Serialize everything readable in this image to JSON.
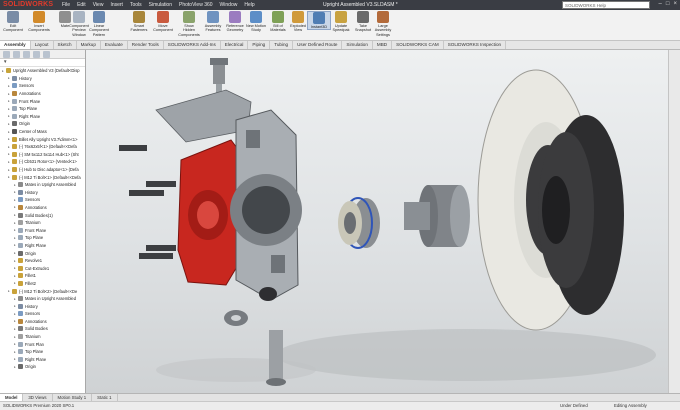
{
  "app": {
    "logo": "SOLIDWORKS",
    "doc_title": "Upright Assembled V3.SLDASM *"
  },
  "menu": [
    "File",
    "Edit",
    "View",
    "Insert",
    "Tools",
    "Simulation",
    "PhotoView 360",
    "Window",
    "Help"
  ],
  "search_placeholder": "SOLIDWORKS Help",
  "ribbon": [
    {
      "label": "Edit Component",
      "icon": "edit-component-icon",
      "color": "#7a8ca6"
    },
    {
      "label": "Insert Components",
      "icon": "insert-components-icon",
      "color": "#d28a2a"
    },
    {
      "label": "Mate",
      "icon": "mate-icon",
      "color": "#8f8f8f"
    },
    {
      "label": "Component Preview Window",
      "icon": "preview-window-icon",
      "color": "#a9b4c2"
    },
    {
      "label": "Linear Component Pattern",
      "icon": "linear-pattern-icon",
      "color": "#6b89b0"
    },
    {
      "label": "Smart Fasteners",
      "icon": "smart-fasteners-icon",
      "color": "#a8863a"
    },
    {
      "label": "Move Component",
      "icon": "move-component-icon",
      "color": "#c95a3e"
    },
    {
      "label": "Show Hidden Components",
      "icon": "show-hidden-icon",
      "color": "#8aa36b"
    },
    {
      "label": "Assembly Features",
      "icon": "assembly-features-icon",
      "color": "#6f93c0"
    },
    {
      "label": "Reference Geometry",
      "icon": "reference-geometry-icon",
      "color": "#9b7cc0"
    },
    {
      "label": "New Motion Study",
      "icon": "motion-study-icon",
      "color": "#5d8ec7"
    },
    {
      "label": "Bill of Materials",
      "icon": "bill-of-materials-icon",
      "color": "#7fa157"
    },
    {
      "label": "Exploded View",
      "icon": "exploded-view-icon",
      "color": "#d09a3b"
    },
    {
      "label": "Instant3D",
      "icon": "instant3d-icon",
      "color": "#4f7db3"
    },
    {
      "label": "Update Speedpak",
      "icon": "update-speedpak-icon",
      "color": "#c8a240"
    },
    {
      "label": "Take Snapshot",
      "icon": "take-snapshot-icon",
      "color": "#6a6a6a"
    },
    {
      "label": "Large Assembly Settings",
      "icon": "large-assembly-icon",
      "color": "#b36a3a"
    }
  ],
  "tabs": [
    "Assembly",
    "Layout",
    "Sketch",
    "Markup",
    "Evaluate",
    "Render Tools",
    "SOLIDWORKS Add-Ins",
    "Electrical",
    "Piping",
    "Tubing",
    "User Defined Route",
    "Simulation",
    "MBD",
    "SOLIDWORKS CAM",
    "SOLIDWORKS Inspection"
  ],
  "tree": {
    "filter_icon": "filter-icon",
    "rows": [
      {
        "label": "Upright Assembled V3 (Default<Disp",
        "level": 0,
        "icon": "assembly-icon",
        "color": "#c7a43a"
      },
      {
        "label": "History",
        "level": 1,
        "icon": "history-icon",
        "color": "#7c8ca3"
      },
      {
        "label": "Sensors",
        "level": 1,
        "icon": "sensors-icon",
        "color": "#7b9bc2"
      },
      {
        "label": "Annotations",
        "level": 1,
        "icon": "annotations-icon",
        "color": "#b9873c"
      },
      {
        "label": "Front Plane",
        "level": 1,
        "icon": "plane-icon",
        "color": "#9ba9b9"
      },
      {
        "label": "Top Plane",
        "level": 1,
        "icon": "plane-icon",
        "color": "#9ba9b9"
      },
      {
        "label": "Right Plane",
        "level": 1,
        "icon": "plane-icon",
        "color": "#9ba9b9"
      },
      {
        "label": "Origin",
        "level": 1,
        "icon": "origin-icon",
        "color": "#6b6b6b"
      },
      {
        "label": "Center of Mass",
        "level": 1,
        "icon": "center-of-mass-icon",
        "color": "#555"
      },
      {
        "label": "Billet Ally Upright V3.7\\dimm<1>",
        "level": 1,
        "icon": "part-icon",
        "color": "#c9a23a"
      },
      {
        "label": "(-) 76x62x5f<1> (Default<<Defa",
        "level": 1,
        "icon": "part-icon",
        "color": "#c9a23a"
      },
      {
        "label": "(-) SM 5x112 5x114 Hub<1> (Sht",
        "level": 1,
        "icon": "part-icon",
        "color": "#c9a23a"
      },
      {
        "label": "(-) Cb531 Rotor<1> (Vented<1>",
        "level": 1,
        "icon": "part-icon",
        "color": "#c9a23a"
      },
      {
        "label": "(-) Hub to Disc adaptor<1> (Defa",
        "level": 1,
        "icon": "part-icon",
        "color": "#c9a23a"
      },
      {
        "label": "(-) M12 Ti Bolt<1> (Default<<Defa",
        "level": 1,
        "icon": "part-icon",
        "color": "#c9a23a"
      },
      {
        "label": "Mates in Upright Assembled",
        "level": 2,
        "icon": "mates-icon",
        "color": "#8b8b8b"
      },
      {
        "label": "History",
        "level": 2,
        "icon": "history-icon",
        "color": "#7c8ca3"
      },
      {
        "label": "Sensors",
        "level": 2,
        "icon": "sensors-icon",
        "color": "#7b9bc2"
      },
      {
        "label": "Annotations",
        "level": 2,
        "icon": "annotations-icon",
        "color": "#b9873c"
      },
      {
        "label": "Solid Bodies(1)",
        "level": 2,
        "icon": "solid-bodies-icon",
        "color": "#7a7a7a"
      },
      {
        "label": "Titanium",
        "level": 2,
        "icon": "material-icon",
        "color": "#a0a0a0"
      },
      {
        "label": "Front Plane",
        "level": 2,
        "icon": "plane-icon",
        "color": "#9ba9b9"
      },
      {
        "label": "Top Plane",
        "level": 2,
        "icon": "plane-icon",
        "color": "#9ba9b9"
      },
      {
        "label": "Right Plane",
        "level": 2,
        "icon": "plane-icon",
        "color": "#9ba9b9"
      },
      {
        "label": "Origin",
        "level": 2,
        "icon": "origin-icon",
        "color": "#6b6b6b"
      },
      {
        "label": "Revolve1",
        "level": 2,
        "icon": "revolve-icon",
        "color": "#c9a23a"
      },
      {
        "label": "Cut-Extrude1",
        "level": 2,
        "icon": "cut-extrude-icon",
        "color": "#c9a23a"
      },
      {
        "label": "Fillet1",
        "level": 2,
        "icon": "fillet-icon",
        "color": "#c9a23a"
      },
      {
        "label": "Fillet2",
        "level": 2,
        "icon": "fillet-icon",
        "color": "#c9a23a"
      },
      {
        "label": "(-) M12 Ti Bolt<2> (Default<<De",
        "level": 1,
        "icon": "part-icon",
        "color": "#c9a23a"
      },
      {
        "label": "Mates in Upright Assembled",
        "level": 2,
        "icon": "mates-icon",
        "color": "#8b8b8b"
      },
      {
        "label": "History",
        "level": 2,
        "icon": "history-icon",
        "color": "#7c8ca3"
      },
      {
        "label": "Sensors",
        "level": 2,
        "icon": "sensors-icon",
        "color": "#7b9bc2"
      },
      {
        "label": "Annotations",
        "level": 2,
        "icon": "annotations-icon",
        "color": "#b9873c"
      },
      {
        "label": "Solid Bodies",
        "level": 2,
        "icon": "solid-bodies-icon",
        "color": "#7a7a7a"
      },
      {
        "label": "Titanium",
        "level": 2,
        "icon": "material-icon",
        "color": "#a0a0a0"
      },
      {
        "label": "Front Plan",
        "level": 2,
        "icon": "plane-icon",
        "color": "#9ba9b9"
      },
      {
        "label": "Top Plane",
        "level": 2,
        "icon": "plane-icon",
        "color": "#9ba9b9"
      },
      {
        "label": "Right Plane",
        "level": 2,
        "icon": "plane-icon",
        "color": "#9ba9b9"
      },
      {
        "label": "Origin",
        "level": 2,
        "icon": "origin-icon",
        "color": "#6b6b6b"
      }
    ]
  },
  "bottom_tabs": [
    "Model",
    "3D Views",
    "Motion Study 1",
    "Static 1"
  ],
  "status": {
    "left": "SOLIDWORKS Premium 2020 SP0.1",
    "middle": "Under Defined",
    "right": "Editing Assembly"
  },
  "colors": {
    "caliper_red": "#c8271f",
    "aluminium": "#a9aeb3",
    "rotor": "#e9e8e2",
    "hat": "#3b3b3d"
  }
}
